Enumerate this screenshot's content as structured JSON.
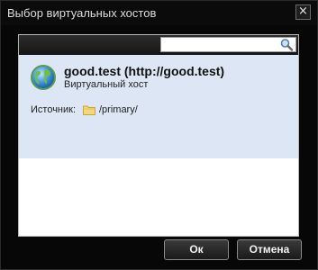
{
  "dialog": {
    "title": "Выбор виртуальных хостов",
    "close_label": "×"
  },
  "search": {
    "value": "",
    "placeholder": ""
  },
  "hosts": [
    {
      "name": "good.test (http://good.test)",
      "type": "Виртуальный хост",
      "source_label": "Источник:",
      "source_path": "/primary/",
      "selected": true
    }
  ],
  "buttons": {
    "ok": "Ок",
    "cancel": "Отмена"
  },
  "colors": {
    "selection_bg": "#dce6f5",
    "dialog_bg": "#070707"
  },
  "icons": {
    "search": "search-icon",
    "host": "globe-icon",
    "folder": "folder-icon",
    "close": "close-icon"
  }
}
